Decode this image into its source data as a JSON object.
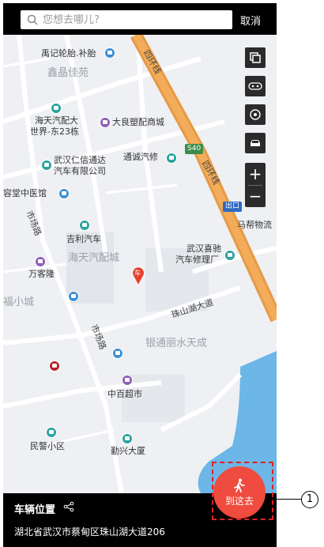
{
  "search": {
    "placeholder": "您想去哪儿?",
    "cancel_label": "取消"
  },
  "map": {
    "labels": [
      "禹记轮胎.补胎",
      "鑫晶佳苑",
      "海天汽配大",
      "世界-东23栋",
      "大良塑配商城",
      "武汉仁信通达",
      "汽车有限公司",
      "通诚汽修",
      "容堂中医馆",
      "吉利汽车",
      "海天汽配城",
      "武汉喜驰",
      "汽车修理厂",
      "万客隆",
      "福小城",
      "银通丽水天成",
      "中百超市",
      "民警小区",
      "勤兴大厦",
      "马帮物流",
      "出口"
    ],
    "roads": [
      "四环线",
      "四环线",
      "市场路",
      "市场路",
      "珠山湖大道"
    ],
    "shield": "S40",
    "marker_label": "车"
  },
  "controls": {
    "zoom_in": "+",
    "zoom_out": "−"
  },
  "bottom": {
    "title": "车辆位置",
    "address": "湖北省武汉市蔡甸区珠山湖大道206",
    "goto_label": "到这去"
  },
  "callout": {
    "number": "1"
  }
}
